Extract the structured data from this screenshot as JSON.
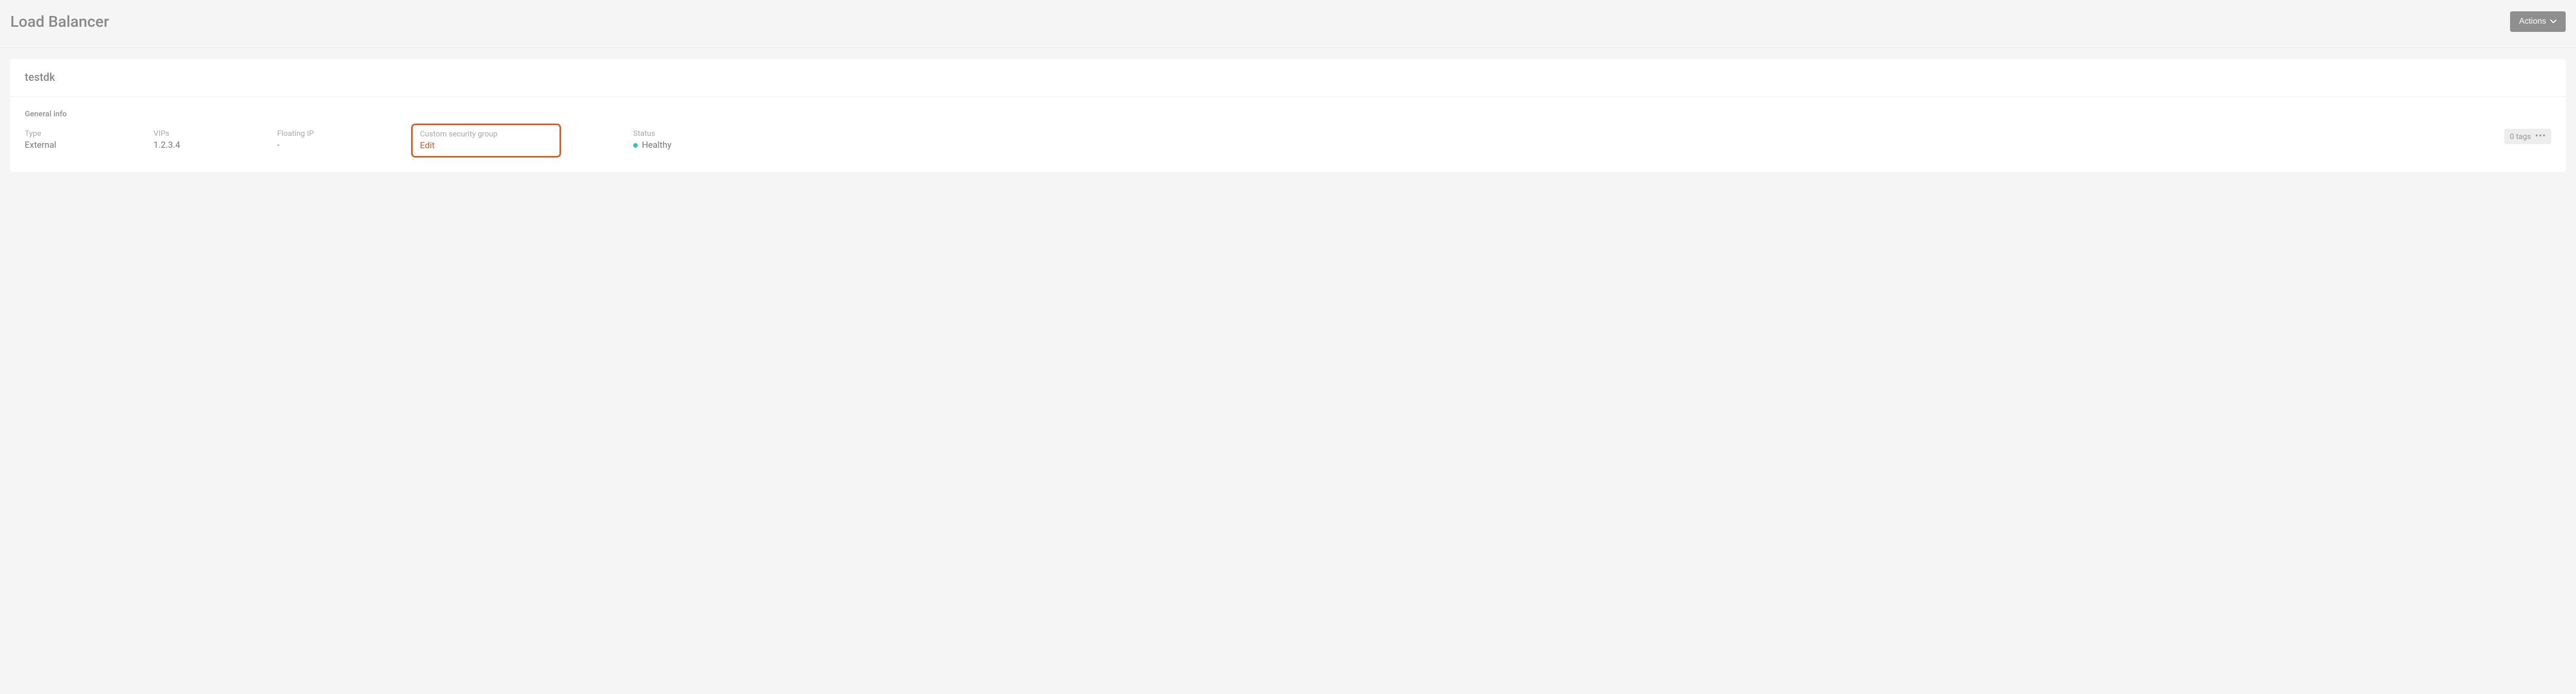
{
  "header": {
    "title": "Load Balancer",
    "actions_label": "Actions"
  },
  "resource": {
    "name": "testdk"
  },
  "general_info": {
    "section_title": "General info",
    "type": {
      "label": "Type",
      "value": "External"
    },
    "vips": {
      "label": "VIPs",
      "value": "1.2.3.4"
    },
    "floating_ip": {
      "label": "Floating IP",
      "value": "-"
    },
    "custom_security_group": {
      "label": "Custom security group",
      "edit_label": "Edit"
    },
    "status": {
      "label": "Status",
      "value": "Healthy"
    },
    "tags": {
      "label": "0 tags"
    }
  }
}
